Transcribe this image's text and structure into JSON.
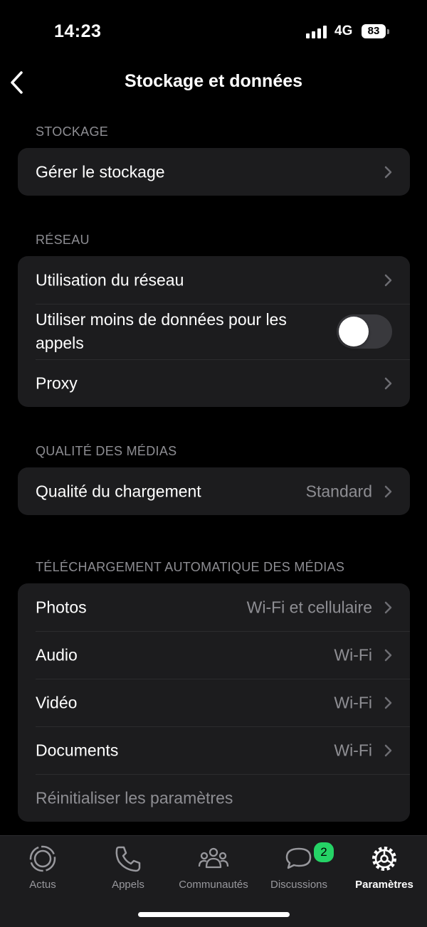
{
  "status_bar": {
    "time": "14:23",
    "network": "4G",
    "battery": "83"
  },
  "nav": {
    "title": "Stockage et données"
  },
  "sections": {
    "storage": {
      "header": "STOCKAGE",
      "items": [
        {
          "label": "Gérer le stockage"
        }
      ]
    },
    "network": {
      "header": "RÉSEAU",
      "items": [
        {
          "label": "Utilisation du réseau"
        },
        {
          "label": "Utiliser moins de données pour les appels",
          "toggle": false
        },
        {
          "label": "Proxy"
        }
      ]
    },
    "media_quality": {
      "header": "QUALITÉ DES MÉDIAS",
      "items": [
        {
          "label": "Qualité du chargement",
          "value": "Standard"
        }
      ]
    },
    "auto_download": {
      "header": "TÉLÉCHARGEMENT AUTOMATIQUE DES MÉDIAS",
      "items": [
        {
          "label": "Photos",
          "value": "Wi-Fi et cellulaire"
        },
        {
          "label": "Audio",
          "value": "Wi-Fi"
        },
        {
          "label": "Vidéo",
          "value": "Wi-Fi"
        },
        {
          "label": "Documents",
          "value": "Wi-Fi"
        }
      ],
      "reset_label": "Réinitialiser les paramètres"
    }
  },
  "tabbar": {
    "tabs": [
      {
        "label": "Actus",
        "icon": "updates-icon"
      },
      {
        "label": "Appels",
        "icon": "phone-icon"
      },
      {
        "label": "Communautés",
        "icon": "communities-icon"
      },
      {
        "label": "Discussions",
        "icon": "chats-icon",
        "badge": "2"
      },
      {
        "label": "Paramètres",
        "icon": "settings-gear-icon",
        "active": true
      }
    ]
  },
  "colors": {
    "background": "#000000",
    "card": "#1c1c1e",
    "secondary_text": "#8e8e93",
    "badge": "#25d366"
  }
}
